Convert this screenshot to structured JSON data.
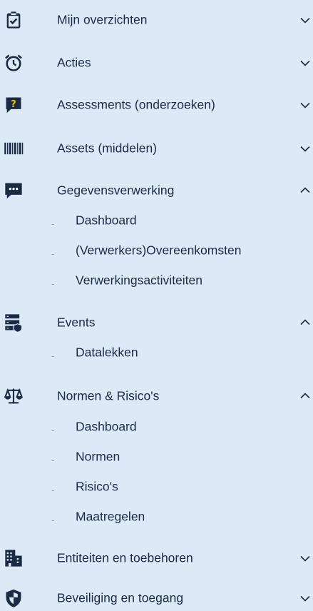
{
  "menu": [
    {
      "label": "Mijn overzichten",
      "icon": "clipboard-check-icon",
      "state": "collapsed"
    },
    {
      "label": "Acties",
      "icon": "alarm-clock-icon",
      "state": "collapsed"
    },
    {
      "label": "Assessments (onderzoeken)",
      "icon": "question-bubble-icon",
      "state": "collapsed"
    },
    {
      "label": "Assets (middelen)",
      "icon": "barcode-icon",
      "state": "collapsed"
    },
    {
      "label": "Gegevensverwerking",
      "icon": "chat-dots-icon",
      "state": "expanded",
      "children": [
        "Dashboard",
        "(Verwerkers)Overeenkomsten",
        "Verwerkingsactiviteiten"
      ]
    },
    {
      "label": "Events",
      "icon": "server-shield-icon",
      "state": "expanded",
      "children": [
        "Datalekken"
      ]
    },
    {
      "label": "Normen & Risico's",
      "icon": "balance-scale-icon",
      "state": "expanded",
      "children": [
        "Dashboard",
        "Normen",
        "Risico's",
        "Maatregelen"
      ]
    },
    {
      "label": "Entiteiten en toebehoren",
      "icon": "building-icon",
      "state": "collapsed"
    },
    {
      "label": "Beveiliging en toegang",
      "icon": "shield-icon",
      "state": "collapsed"
    }
  ],
  "sub_bullet": "-",
  "colors": {
    "background": "#dde9f6",
    "text": "#1c2a43",
    "icon": "#1c2a43",
    "bullet": "#8f9bad"
  }
}
